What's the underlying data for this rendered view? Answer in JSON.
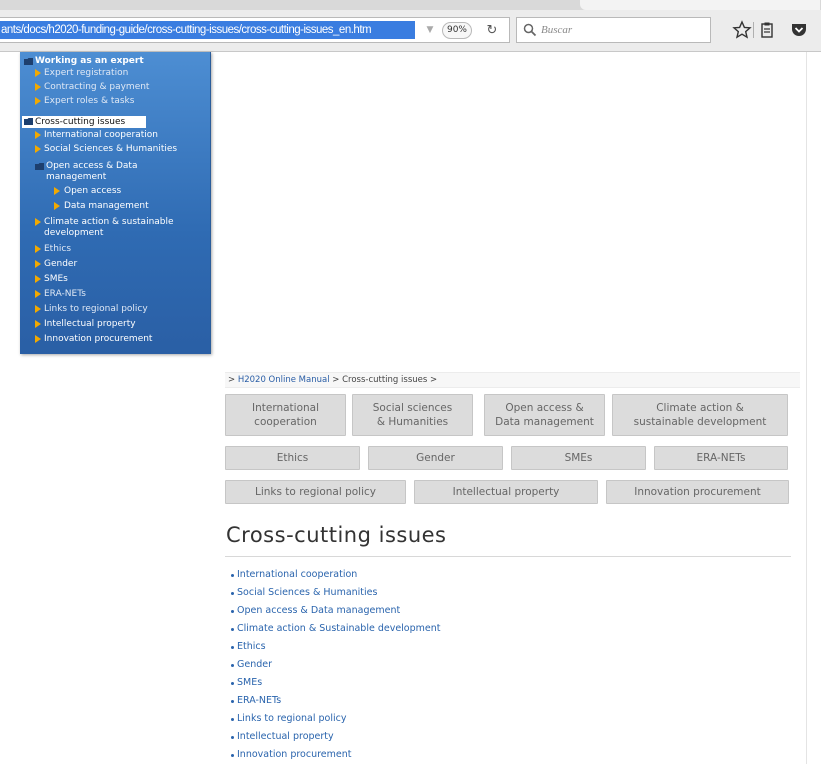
{
  "browser": {
    "url": "ants/docs/h2020-funding-guide/cross-cutting-issues/cross-cutting-issues_en.htm",
    "zoom": "90%",
    "search_placeholder": "Buscar"
  },
  "sidebar": {
    "items": [
      {
        "label": "Working as an expert",
        "kind": "folder"
      },
      {
        "label": "Expert registration",
        "kind": "link"
      },
      {
        "label": "Contracting & payment",
        "kind": "link"
      },
      {
        "label": "Expert roles & tasks",
        "kind": "link"
      },
      {
        "label": "Cross-cutting issues",
        "kind": "folder-open",
        "selected": true
      },
      {
        "label": "International cooperation",
        "kind": "link"
      },
      {
        "label": "Social Sciences & Humanities",
        "kind": "link"
      },
      {
        "label_line1": "Open access & Data",
        "label_line2": "management",
        "kind": "folder-open"
      },
      {
        "label": "Open access",
        "kind": "sublink"
      },
      {
        "label": "Data management",
        "kind": "sublink"
      },
      {
        "label_line1": "Climate action & sustainable",
        "label_line2": "development",
        "kind": "link"
      },
      {
        "label": "Ethics",
        "kind": "link"
      },
      {
        "label": "Gender",
        "kind": "link"
      },
      {
        "label": "SMEs",
        "kind": "link"
      },
      {
        "label": "ERA-NETs",
        "kind": "link"
      },
      {
        "label": "Links to regional policy",
        "kind": "link"
      },
      {
        "label": "Intellectual property",
        "kind": "link"
      },
      {
        "label": "Innovation procurement",
        "kind": "link"
      }
    ]
  },
  "breadcrumb": {
    "prefix": "> ",
    "home": "H2020 Online Manual",
    "sep": " > ",
    "current": "Cross-cutting issues",
    "suffix": " >"
  },
  "topic_buttons": {
    "row1": [
      {
        "line1": "International",
        "line2": "cooperation"
      },
      {
        "line1": "Social sciences",
        "line2": "& Humanities"
      },
      {
        "line1": "Open access &",
        "line2": "Data management"
      },
      {
        "line1": "Climate action &",
        "line2": "sustainable development"
      }
    ],
    "row2": [
      "Ethics",
      "Gender",
      "SMEs",
      "ERA-NETs"
    ],
    "row3": [
      "Links to regional policy",
      "Intellectual property",
      "Innovation procurement"
    ]
  },
  "page": {
    "title": "Cross-cutting issues"
  },
  "issue_list": [
    "International cooperation",
    "Social Sciences & Humanities",
    "Open access & Data management",
    "Climate action & Sustainable development",
    "Ethics",
    "Gender",
    "SMEs",
    "ERA-NETs",
    "Links to regional policy",
    "Intellectual property",
    "Innovation procurement"
  ],
  "colors": {
    "sidebar_blue": "#3d7cc6",
    "link_blue": "#2a64ad",
    "button_grey": "#dcdcdc",
    "url_highlight": "#3a7de0"
  }
}
